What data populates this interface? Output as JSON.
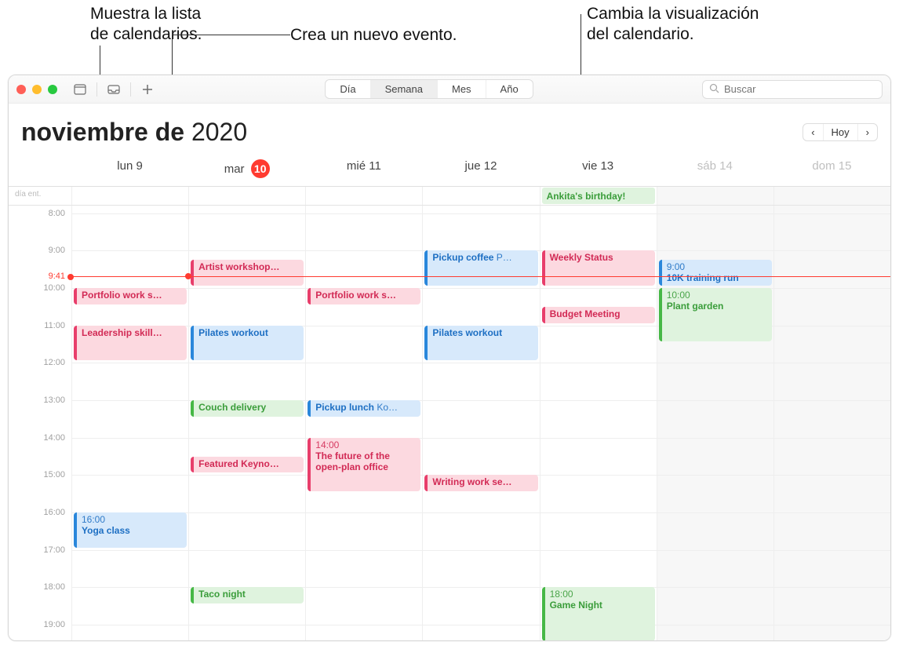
{
  "callouts": {
    "showList": "Muestra la lista\nde calendarios.",
    "newEvent": "Crea un nuevo evento.",
    "changeView": "Cambia la visualización\ndel calendario."
  },
  "toolbar": {
    "views": {
      "day": "Día",
      "week": "Semana",
      "month": "Mes",
      "year": "Año"
    },
    "search_placeholder": "Buscar",
    "today": "Hoy"
  },
  "title": {
    "month": "noviembre de",
    "year": "2020"
  },
  "days": {
    "allday_label": "día ent.",
    "labels": [
      {
        "name": "lun",
        "num": "9"
      },
      {
        "name": "mar",
        "num": "10",
        "today": true
      },
      {
        "name": "mié",
        "num": "11"
      },
      {
        "name": "jue",
        "num": "12"
      },
      {
        "name": "vie",
        "num": "13"
      },
      {
        "name": "sáb",
        "num": "14",
        "weekend": true
      },
      {
        "name": "dom",
        "num": "15",
        "weekend": true
      }
    ]
  },
  "time": {
    "now": "9:41",
    "hours": [
      "8:00",
      "9:00",
      "10:00",
      "11:00",
      "12:00",
      "13:00",
      "14:00",
      "15:00",
      "16:00",
      "17:00",
      "18:00",
      "19:00"
    ]
  },
  "allday_events": {
    "vie": "Ankita's birthday!"
  },
  "events": {
    "lun": [
      {
        "title": "Portfolio work s…",
        "color": "pink",
        "start": 10,
        "dur": 0.5
      },
      {
        "title": "Leadership skill…",
        "color": "pink",
        "start": 11,
        "dur": 1
      },
      {
        "title": "Yoga class",
        "time": "16:00",
        "color": "blue",
        "start": 16,
        "dur": 1
      }
    ],
    "mar": [
      {
        "title": "Artist workshop…",
        "color": "pink",
        "start": 9.25,
        "dur": 0.75
      },
      {
        "title": "Pilates workout",
        "color": "blue",
        "start": 11,
        "dur": 1
      },
      {
        "title": "Couch delivery",
        "color": "green",
        "start": 13,
        "dur": 0.5
      },
      {
        "title": "Featured Keyno…",
        "color": "pink",
        "start": 14.5,
        "dur": 0.5
      },
      {
        "title": "Taco night",
        "color": "green",
        "start": 18,
        "dur": 0.5
      }
    ],
    "mie": [
      {
        "title": "Portfolio work s…",
        "color": "pink",
        "start": 10,
        "dur": 0.5
      },
      {
        "title": "Pickup lunch",
        "extra": "Ko…",
        "color": "blue",
        "start": 13,
        "dur": 0.5
      },
      {
        "title": "The future of the open-plan office",
        "time": "14:00",
        "color": "pink",
        "start": 14,
        "dur": 1.5,
        "multiline": true
      }
    ],
    "jue": [
      {
        "title": "Pickup coffee",
        "extra": "P…",
        "color": "blue",
        "start": 9,
        "dur": 1
      },
      {
        "title": "Pilates workout",
        "color": "blue",
        "start": 11,
        "dur": 1
      },
      {
        "title": "Writing work se…",
        "color": "pink",
        "start": 15,
        "dur": 0.5
      }
    ],
    "vie": [
      {
        "title": "Weekly Status",
        "color": "pink",
        "start": 9,
        "dur": 1
      },
      {
        "title": "Budget Meeting",
        "color": "pink",
        "start": 10.5,
        "dur": 0.5
      },
      {
        "title": "Game Night",
        "time": "18:00",
        "color": "green",
        "start": 18,
        "dur": 1.5
      }
    ],
    "sab": [
      {
        "title": "10K training run",
        "time": "9:00",
        "color": "blue",
        "start": 9.25,
        "dur": 0.75
      },
      {
        "title": "Plant garden",
        "time": "10:00",
        "color": "green",
        "start": 10,
        "dur": 1.5
      }
    ],
    "dom": []
  }
}
